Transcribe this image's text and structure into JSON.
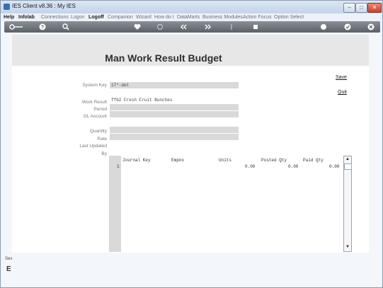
{
  "window": {
    "title": "IES Client v8.36 : My IES",
    "min_glyph": "–",
    "max_glyph": "□",
    "close_glyph": "✕"
  },
  "menu": {
    "items": [
      "Help",
      "Infolab",
      "Connections",
      "Logon",
      "Logoff",
      "Companion",
      "Wizard",
      "How do I",
      "DataMarts",
      "Business Modules",
      "Action Focus",
      "Option Select"
    ],
    "bold_items": [
      "Help",
      "Infolab",
      "Logoff"
    ]
  },
  "toolbar": {
    "icons": [
      "key-icon",
      "help-icon",
      "search-icon",
      "heart-icon",
      "refresh-icon",
      "back-icon",
      "forward-icon",
      "up-icon",
      "stop-icon",
      "print-icon",
      "check-icon",
      "close-icon"
    ]
  },
  "page": {
    "title": "Man Work Result Budget",
    "save_label": "Save",
    "quit_label": "Quit"
  },
  "form": {
    "system_key_label": "System Key",
    "system_key_value": "17*-det",
    "work_result_label": "Work Result",
    "work_result_value": "ffb2 Fresh Fruit Bunches",
    "period_label": "Period",
    "period_value": "",
    "gl_account_label": "GL Account",
    "gl_account_value": "",
    "quantity_label": "Quantity",
    "quantity_value": "",
    "rate_label": "Rate",
    "rate_value": "",
    "last_updated_label": "Last Updated",
    "by_label": "By"
  },
  "grid": {
    "columns": [
      "Journal Key",
      "Empno",
      "Units",
      "Posted Qty",
      "Paid Qty"
    ],
    "rows": [
      {
        "row_no": "1",
        "journal_key": "",
        "empno": "",
        "units": "0.00",
        "posted_qty": "0.00",
        "paid_qty": "0.00"
      }
    ],
    "scroll_up": "▲",
    "scroll_down": "▼"
  },
  "status": {
    "left_text": "Ses",
    "glyph": "E"
  }
}
